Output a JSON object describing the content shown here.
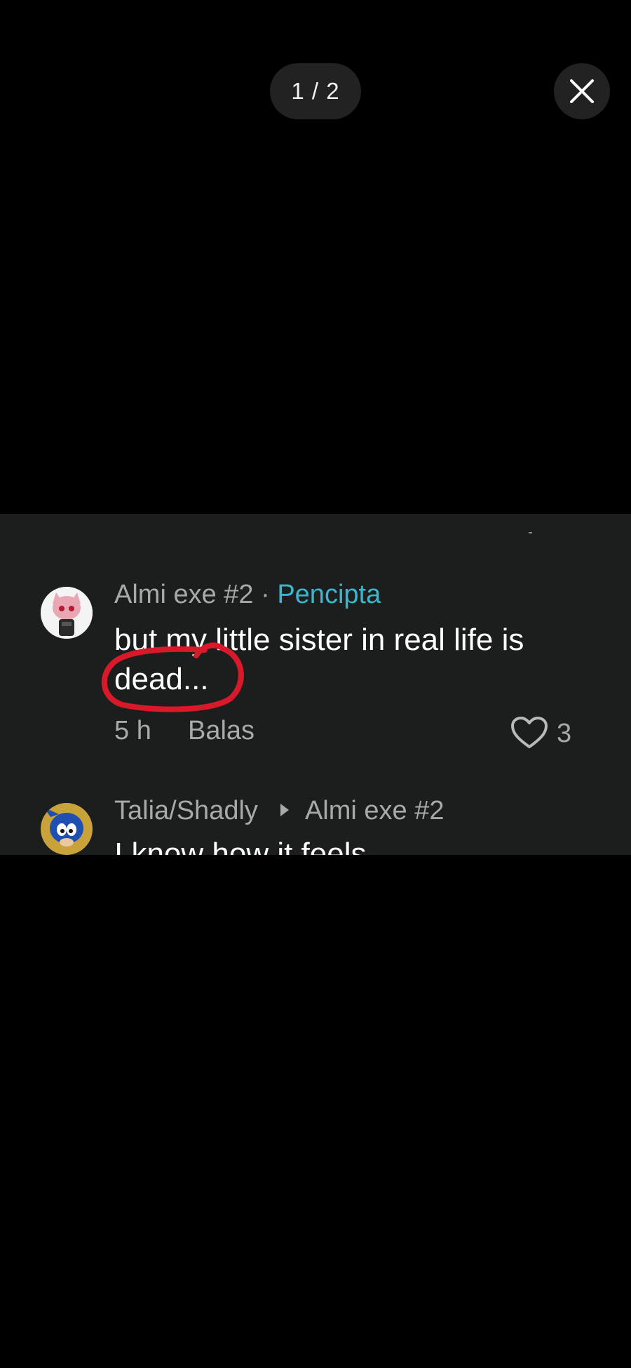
{
  "viewer": {
    "counter": "1 / 2",
    "close_icon": "close-icon"
  },
  "comments": [
    {
      "author": "Almi exe #2",
      "separator": "·",
      "tag": "Pencipta",
      "text": "but my little sister in real life is dead...",
      "time": "5 h",
      "reply_label": "Balas",
      "likes": "3"
    },
    {
      "author": "Talia/Shadly",
      "reply_to": "Almi exe #2",
      "text": "I know how it feels"
    }
  ],
  "colors": {
    "background": "#000000",
    "panel": "#1c1e1e",
    "tag": "#3ab6cf",
    "annotation": "#d8192a",
    "muted_text": "#a7a9ab"
  }
}
